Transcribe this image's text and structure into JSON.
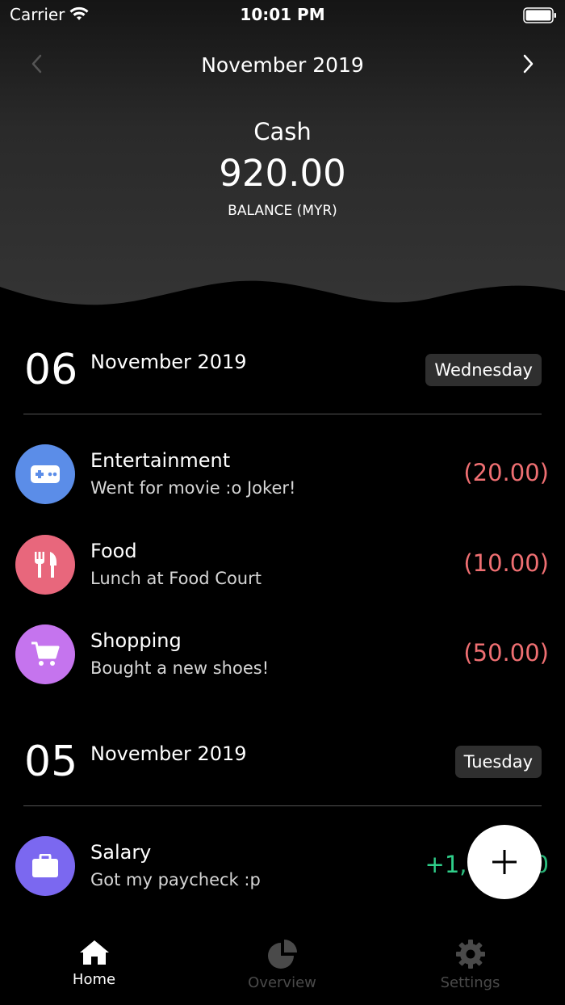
{
  "status_bar": {
    "carrier": "Carrier",
    "time": "10:01 PM"
  },
  "header": {
    "month_title": "November 2019",
    "account_name": "Cash",
    "balance": "920.00",
    "balance_label": "BALANCE (MYR)"
  },
  "days": [
    {
      "day_number": "06",
      "month_year": "November 2019",
      "weekday": "Wednesday",
      "transactions": [
        {
          "category": "Entertainment",
          "note": "Went for movie :o Joker!",
          "amount": "(20.00)",
          "icon": "gamepad-icon",
          "color": "#5b8de8"
        },
        {
          "category": "Food",
          "note": "Lunch at Food Court",
          "amount": "(10.00)",
          "icon": "cutlery-icon",
          "color": "#e8677c"
        },
        {
          "category": "Shopping",
          "note": "Bought a new shoes!",
          "amount": "(50.00)",
          "icon": "cart-icon",
          "color": "#c574ee"
        }
      ]
    },
    {
      "day_number": "05",
      "month_year": "November 2019",
      "weekday": "Tuesday",
      "transactions": [
        {
          "category": "Salary",
          "note": "Got my paycheck :p",
          "amount": "+1,000.00",
          "icon": "briefcase-icon",
          "color": "#7b68f0"
        }
      ]
    }
  ],
  "tabbar": {
    "items": [
      {
        "label": "Home",
        "icon": "home-icon",
        "active": true
      },
      {
        "label": "Overview",
        "icon": "pie-chart-icon",
        "active": false
      },
      {
        "label": "Settings",
        "icon": "gear-icon",
        "active": false
      }
    ]
  },
  "colors": {
    "expense": "#ef6f72",
    "income": "#2fcf8a",
    "badge_bg": "#2f2f2f"
  }
}
